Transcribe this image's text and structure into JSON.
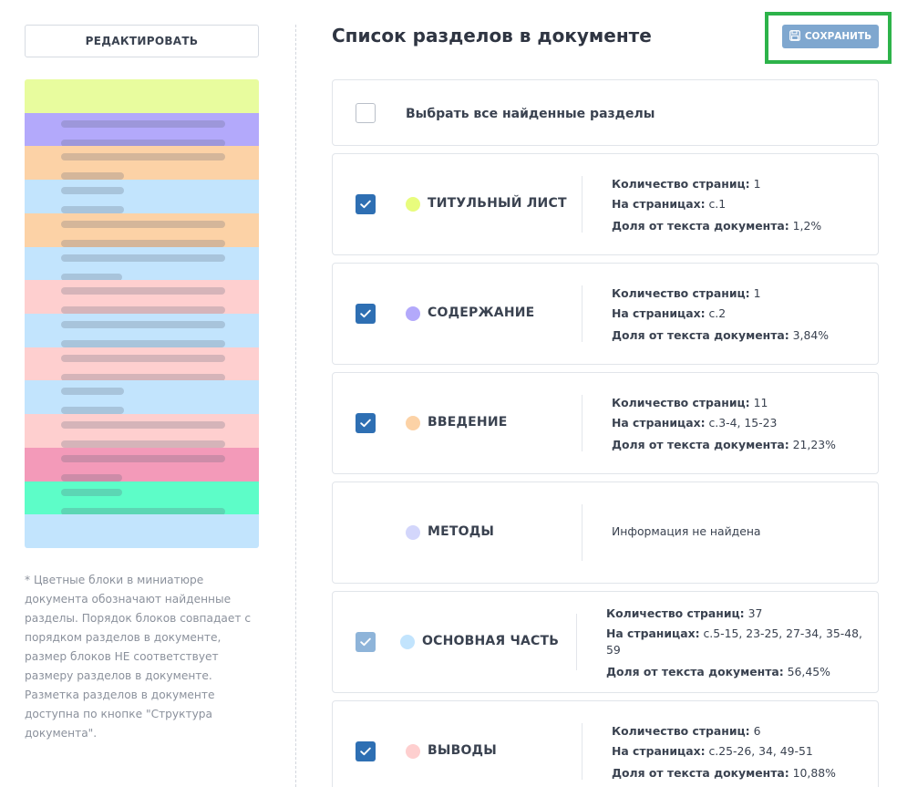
{
  "edit_button": "РЕДАКТИРОВАТЬ",
  "minimap": {
    "blocks": [
      {
        "color": "#e8fc9e",
        "lines": []
      },
      {
        "color": "#b3a9fb",
        "lines": [
          0.7,
          0.7
        ]
      },
      {
        "color": "#fcd2a6",
        "lines": [
          0.7,
          0.27
        ]
      },
      {
        "color": "#c2e4fd",
        "lines": [
          0.27,
          0.27
        ]
      },
      {
        "color": "#fcd2a6",
        "lines": [
          0.7,
          0.7
        ]
      },
      {
        "color": "#c2e4fd",
        "lines": [
          0.7,
          0.26
        ]
      },
      {
        "color": "#fecfcf",
        "lines": [
          0.7,
          0.7
        ]
      },
      {
        "color": "#c2e4fd",
        "lines": [
          0.7,
          0.7
        ]
      },
      {
        "color": "#fecfcf",
        "lines": [
          0.7,
          0.7
        ]
      },
      {
        "color": "#c2e4fd",
        "lines": [
          0.27,
          0.27
        ]
      },
      {
        "color": "#fecfcf",
        "lines": [
          0.7,
          0.7
        ]
      },
      {
        "color": "#f39ab9",
        "lines": [
          0.7,
          0.26
        ]
      },
      {
        "color": "#5dfdc8",
        "lines": [
          0.26,
          0.7
        ]
      },
      {
        "color": "#c2e4fd",
        "lines": []
      }
    ]
  },
  "footnote": "* Цветные блоки в миниатюре документа обозначают найденные разделы. Порядок блоков совпадает с порядком разделов в документе, размер блоков НЕ соответствует размеру разделов в документе. Разметка разделов в документе доступна по кнопке \"Структура документа\".",
  "title": "Список разделов в документе",
  "save_button": "СОХРАНИТЬ",
  "select_all": "Выбрать все найденные разделы",
  "labels": {
    "pages_count": "Количество страниц:",
    "on_pages": "На страницах:",
    "share": "Доля от текста документа:"
  },
  "sections": [
    {
      "name": "ТИТУЛЬНЫЙ ЛИСТ",
      "color": "#e8fc7d",
      "checked": "on",
      "pages_count": "1",
      "on_pages": "с.1",
      "share": "1,2%"
    },
    {
      "name": "СОДЕРЖАНИЕ",
      "color": "#b3a9fb",
      "checked": "on",
      "pages_count": "1",
      "on_pages": "с.2",
      "share": "3,84%"
    },
    {
      "name": "ВВЕДЕНИЕ",
      "color": "#fcd2a6",
      "checked": "on",
      "pages_count": "11",
      "on_pages": "с.3-4, 15-23",
      "share": "21,23%"
    },
    {
      "name": "МЕТОДЫ",
      "color": "#d3d6fb",
      "checked": "none",
      "not_found": "Информация не найдена"
    },
    {
      "name": "ОСНОВНАЯ ЧАСТЬ",
      "color": "#c2e4fd",
      "checked": "faded",
      "pages_count": "37",
      "on_pages": "с.5-15, 23-25, 27-34, 35-48, 59",
      "share": "56,45%"
    },
    {
      "name": "ВЫВОДЫ",
      "color": "#fecfcf",
      "checked": "on",
      "pages_count": "6",
      "on_pages": "с.25-26, 34, 49-51",
      "share": "10,88%"
    }
  ]
}
